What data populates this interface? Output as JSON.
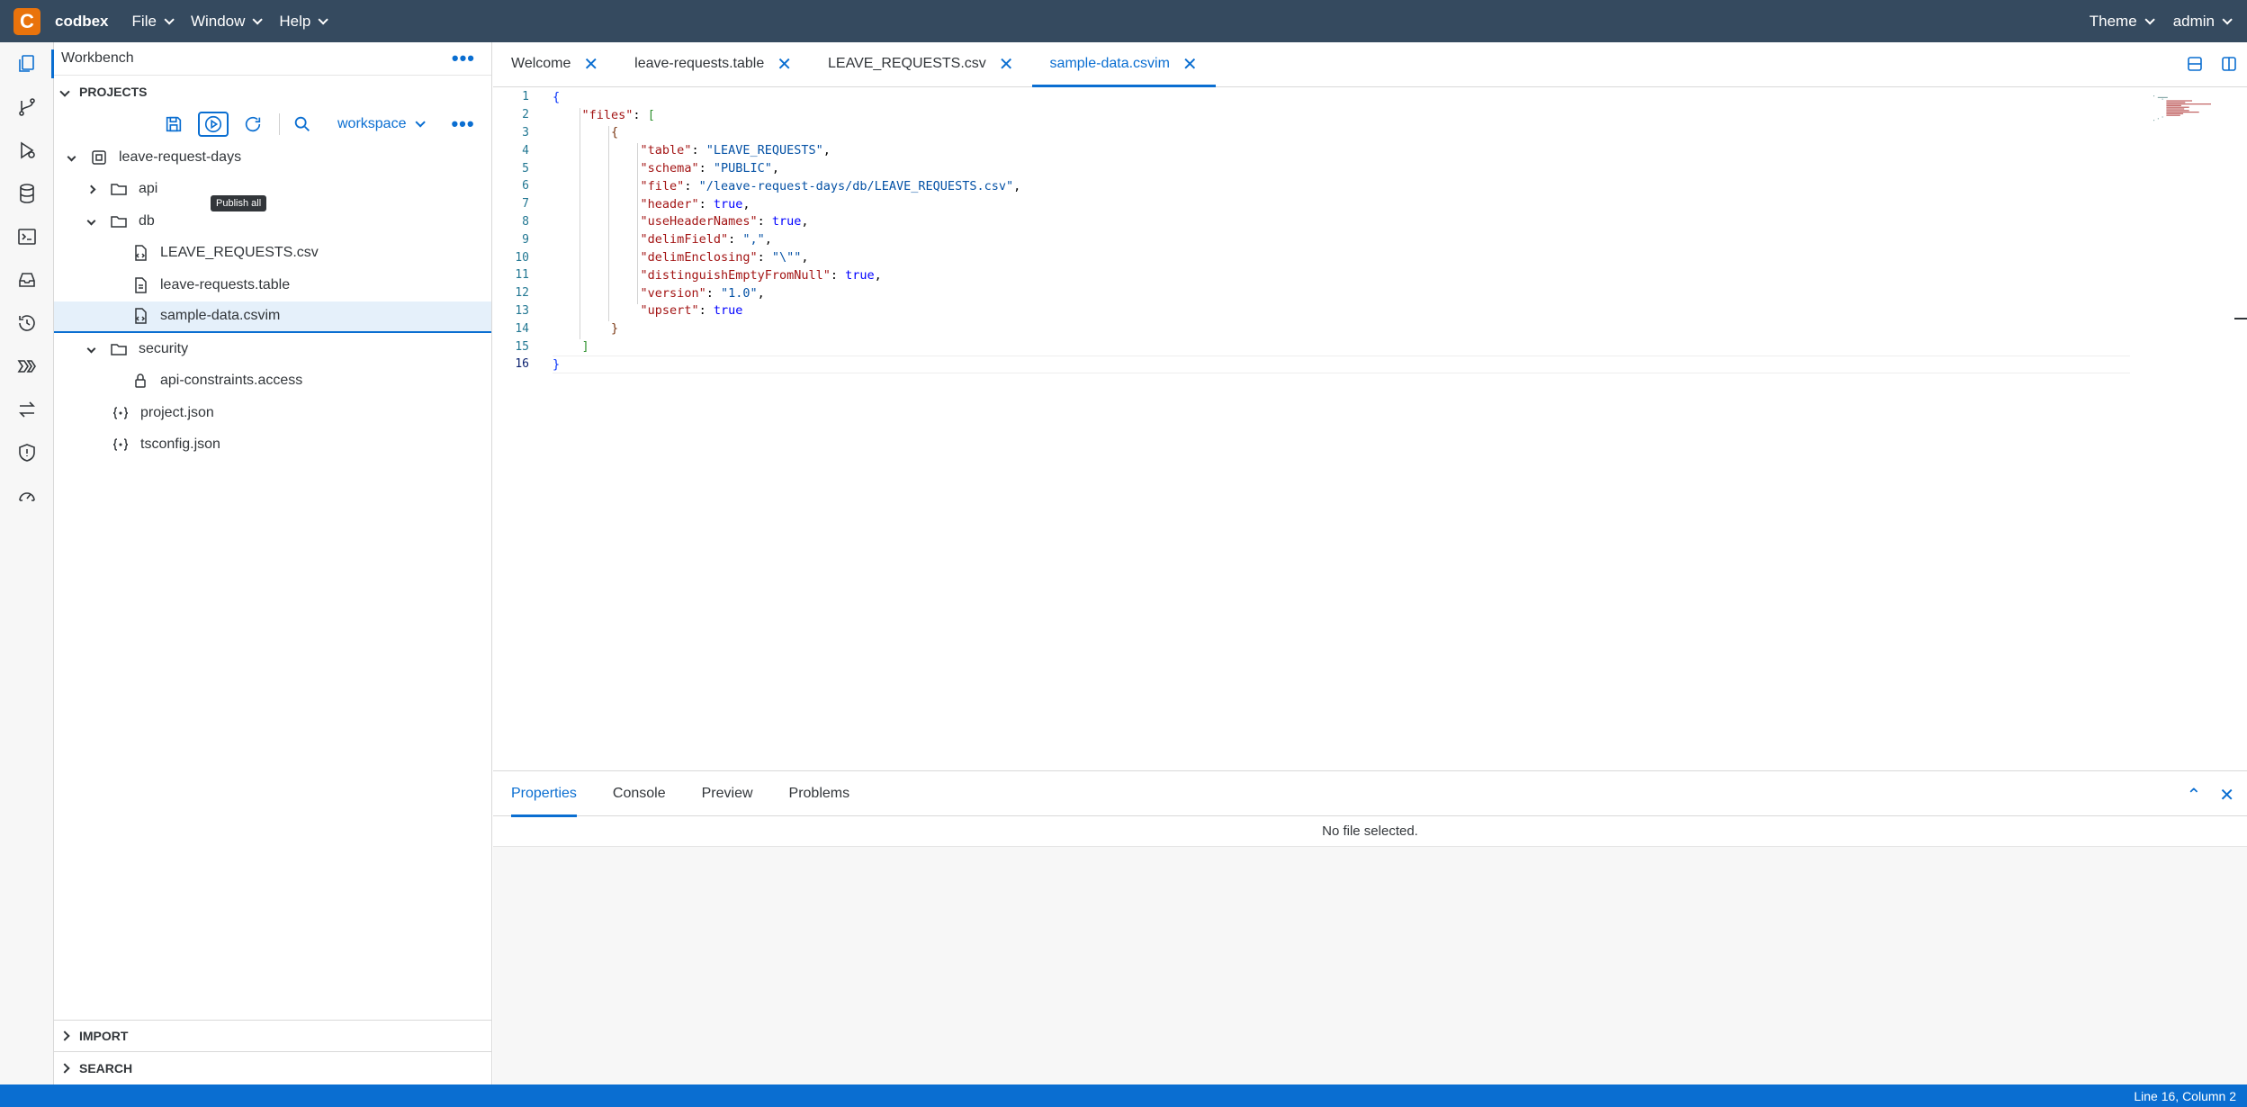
{
  "app": {
    "brand": "codbex",
    "menus": [
      "File",
      "Window",
      "Help"
    ],
    "right_menus": [
      "Theme",
      "admin"
    ]
  },
  "sidebar": {
    "title": "Workbench",
    "projects_label": "PROJECTS",
    "workspace": "workspace",
    "tooltip": "Publish all",
    "tree": [
      {
        "label": "leave-request-days",
        "icon": "project-icon",
        "depth": 0,
        "expanded": true
      },
      {
        "label": "api",
        "icon": "folder-icon",
        "depth": 1,
        "expanded": false
      },
      {
        "label": "db",
        "icon": "folder-icon",
        "depth": 1,
        "expanded": true
      },
      {
        "label": "LEAVE_REQUESTS.csv",
        "icon": "file-code-icon",
        "depth": 2
      },
      {
        "label": "leave-requests.table",
        "icon": "file-icon",
        "depth": 2
      },
      {
        "label": "sample-data.csvim",
        "icon": "file-code-icon",
        "depth": 2,
        "selected": true
      },
      {
        "label": "security",
        "icon": "folder-icon",
        "depth": 1,
        "expanded": true
      },
      {
        "label": "api-constraints.access",
        "icon": "lock-icon",
        "depth": 2
      },
      {
        "label": "project.json",
        "icon": "json-icon",
        "depth": 1
      },
      {
        "label": "tsconfig.json",
        "icon": "json-icon",
        "depth": 1
      }
    ],
    "import_label": "IMPORT",
    "search_label": "SEARCH"
  },
  "editor": {
    "tabs": [
      {
        "label": "Welcome",
        "active": false
      },
      {
        "label": "leave-requests.table",
        "active": false
      },
      {
        "label": "LEAVE_REQUESTS.csv",
        "active": false
      },
      {
        "label": "sample-data.csvim",
        "active": true
      }
    ],
    "lines": [
      "{",
      "    \"files\": [",
      "        {",
      "            \"table\": \"LEAVE_REQUESTS\",",
      "            \"schema\": \"PUBLIC\",",
      "            \"file\": \"/leave-request-days/db/LEAVE_REQUESTS.csv\",",
      "            \"header\": true,",
      "            \"useHeaderNames\": true,",
      "            \"delimField\": \",\",",
      "            \"delimEnclosing\": \"\\\"\",",
      "            \"distinguishEmptyFromNull\": true,",
      "            \"version\": \"1.0\",",
      "            \"upsert\": true",
      "        }",
      "    ]",
      "}"
    ],
    "current_line": 16
  },
  "bottom_panel": {
    "tabs": [
      {
        "label": "Properties",
        "active": true
      },
      {
        "label": "Console",
        "active": false
      },
      {
        "label": "Preview",
        "active": false
      },
      {
        "label": "Problems",
        "active": false
      }
    ],
    "message": "No file selected."
  },
  "status": {
    "position": "Line 16, Column 2"
  },
  "colors": {
    "topbar": "#354a5f",
    "accent": "#0a6ed1",
    "logo": "#e9730c"
  }
}
